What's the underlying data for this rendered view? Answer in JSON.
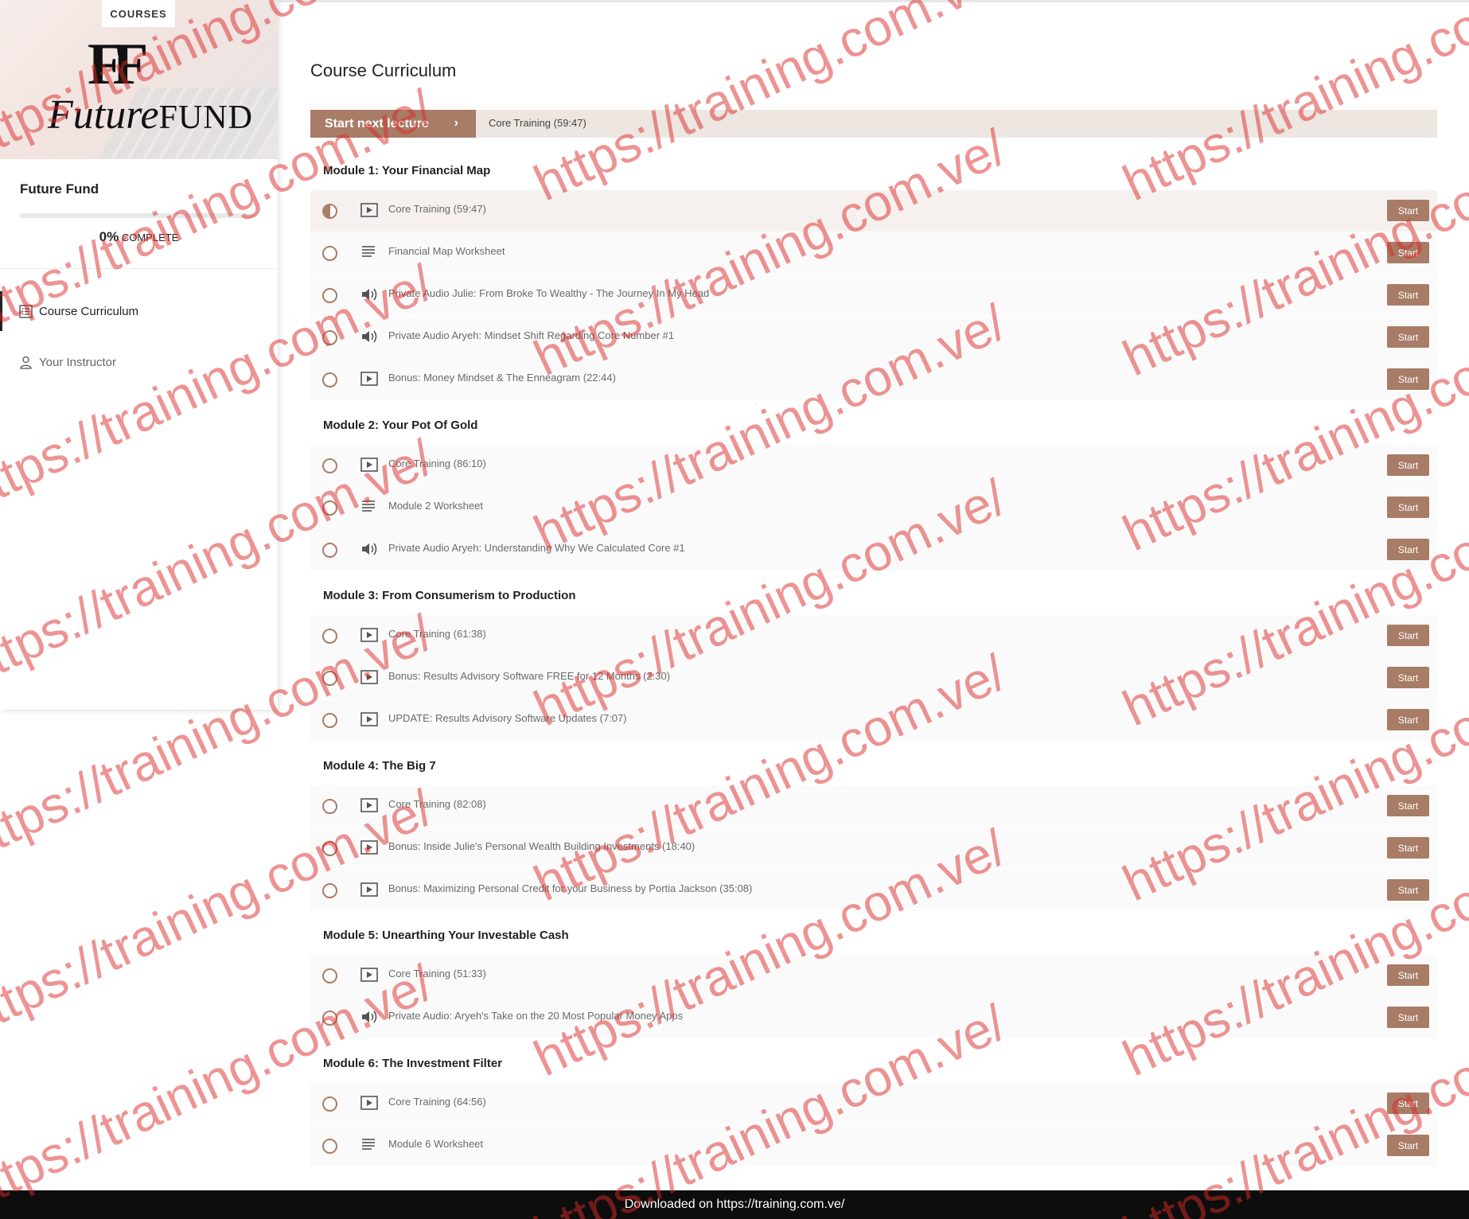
{
  "sidebar": {
    "courses_tab": "COURSES",
    "logo_mark": "FF",
    "logo_word_script": "Future",
    "logo_word_bold": "FUND",
    "course_name": "Future Fund",
    "progress_percent": 0,
    "progress_percent_label": "0%",
    "progress_complete_label": "COMPLETE",
    "nav": [
      {
        "label": "Course Curriculum",
        "icon": "curriculum-list-icon",
        "active": true
      },
      {
        "label": "Your Instructor",
        "icon": "user-icon",
        "active": false
      }
    ]
  },
  "main": {
    "title": "Course Curriculum",
    "next_lecture_button": "Start next lecture",
    "next_lecture_info": "Core Training (59:47)",
    "start_label": "Start",
    "modules": [
      {
        "title": "Module 1: Your Financial Map",
        "lectures": [
          {
            "label": "Core Training (59:47)",
            "type": "video",
            "status": "in-progress"
          },
          {
            "label": "Financial Map Worksheet",
            "type": "text",
            "status": "not-started"
          },
          {
            "label": "Private Audio Julie: From Broke To Wealthy - The Journey In My Head",
            "type": "audio",
            "status": "not-started"
          },
          {
            "label": "Private Audio Aryeh: Mindset Shift Regarding Core Number #1",
            "type": "audio",
            "status": "not-started"
          },
          {
            "label": "Bonus: Money Mindset & The Enneagram (22:44)",
            "type": "video",
            "status": "not-started"
          }
        ]
      },
      {
        "title": "Module 2: Your Pot Of Gold",
        "lectures": [
          {
            "label": "Core Training (86:10)",
            "type": "video",
            "status": "not-started"
          },
          {
            "label": "Module 2 Worksheet",
            "type": "text",
            "status": "not-started"
          },
          {
            "label": "Private Audio Aryeh: Understanding Why We Calculated Core #1",
            "type": "audio",
            "status": "not-started"
          }
        ]
      },
      {
        "title": "Module 3: From Consumerism to Production",
        "lectures": [
          {
            "label": "Core Training (61:38)",
            "type": "video",
            "status": "not-started"
          },
          {
            "label": "Bonus: Results Advisory Software FREE for 12 Months (2:30)",
            "type": "video",
            "status": "not-started"
          },
          {
            "label": "UPDATE: Results Advisory Software Updates (7:07)",
            "type": "video",
            "status": "not-started"
          }
        ]
      },
      {
        "title": "Module 4: The Big 7",
        "lectures": [
          {
            "label": "Core Training (82:08)",
            "type": "video",
            "status": "not-started"
          },
          {
            "label": "Bonus: Inside Julie's Personal Wealth Building Investments (18:40)",
            "type": "video",
            "status": "not-started"
          },
          {
            "label": "Bonus: Maximizing Personal Credit for your Business by Portia Jackson (35:08)",
            "type": "video",
            "status": "not-started"
          }
        ]
      },
      {
        "title": "Module 5: Unearthing Your Investable Cash",
        "lectures": [
          {
            "label": "Core Training (51:33)",
            "type": "video",
            "status": "not-started"
          },
          {
            "label": "Private Audio: Aryeh's Take on the 20 Most Popular Money Apps",
            "type": "audio",
            "status": "not-started"
          }
        ]
      },
      {
        "title": "Module 6: The Investment Filter",
        "lectures": [
          {
            "label": "Core Training (64:56)",
            "type": "video",
            "status": "not-started"
          },
          {
            "label": "Module 6 Worksheet",
            "type": "text",
            "status": "not-started"
          }
        ]
      }
    ]
  },
  "watermark": "https://training.com.ve/",
  "footer": "Downloaded on https://training.com.ve/",
  "colors": {
    "accent": "#a87c66",
    "next_bar_bg": "#ede6e1",
    "row_bg": "#fafafa",
    "footer_bg": "#0d0d0d",
    "watermark": "#dc2828"
  }
}
